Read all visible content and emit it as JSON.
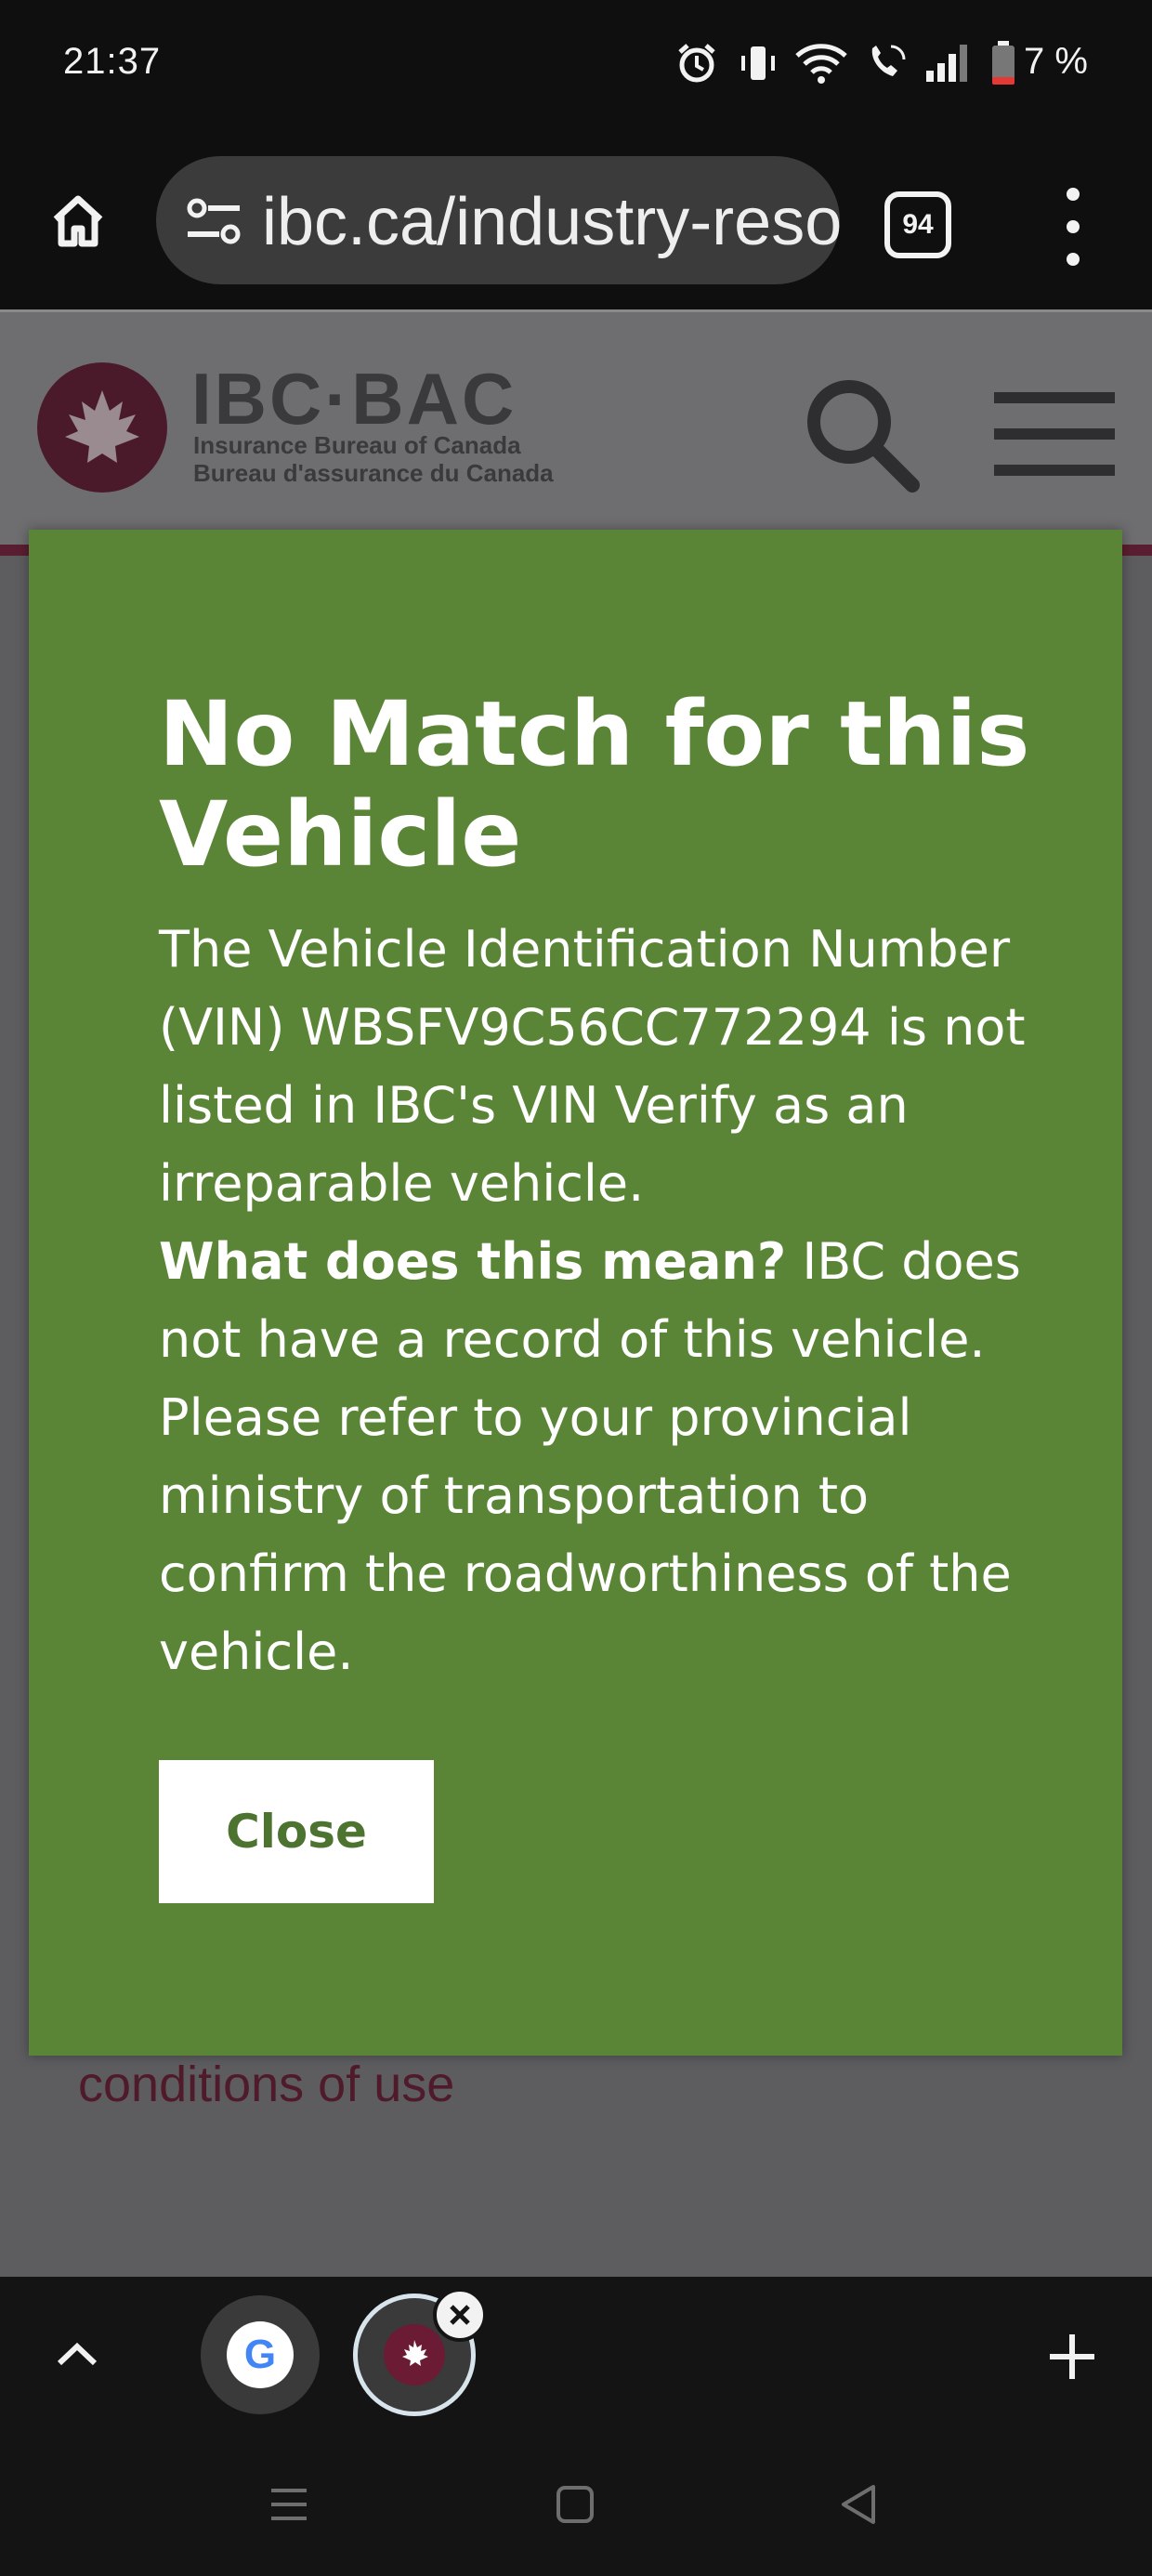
{
  "status_bar": {
    "time": "21:37",
    "battery_percent": "7 %",
    "icons": [
      "alarm-icon",
      "vibrate-icon",
      "wifi-icon",
      "wifi-calling-icon",
      "signal-icon",
      "battery-low-icon"
    ]
  },
  "browser": {
    "url": "ibc.ca/industry-resources",
    "tab_count": "94"
  },
  "site": {
    "logo_title": "IBC·BAC",
    "logo_sub_en": "Insurance Bureau of Canada",
    "logo_sub_fr": "Bureau d'assurance du Canada",
    "conditions_link": "conditions of use",
    "brand_color": "#5b1e30"
  },
  "modal": {
    "title": "No Match for this Vehicle",
    "body_intro": "The Vehicle Identification Number (VIN) WBSFV9C56CC772294 is not listed in IBC's VIN Verify as an irreparable vehicle.",
    "question_label": "What does this mean?",
    "answer": " IBC does not have a record of this vehicle. Please refer to your provincial ministry of transportation to confirm the roadworthiness of the vehicle.",
    "close_label": "Close",
    "background_color": "#5a8536"
  },
  "tab_strip": {
    "google_tab_glyph": "G"
  }
}
